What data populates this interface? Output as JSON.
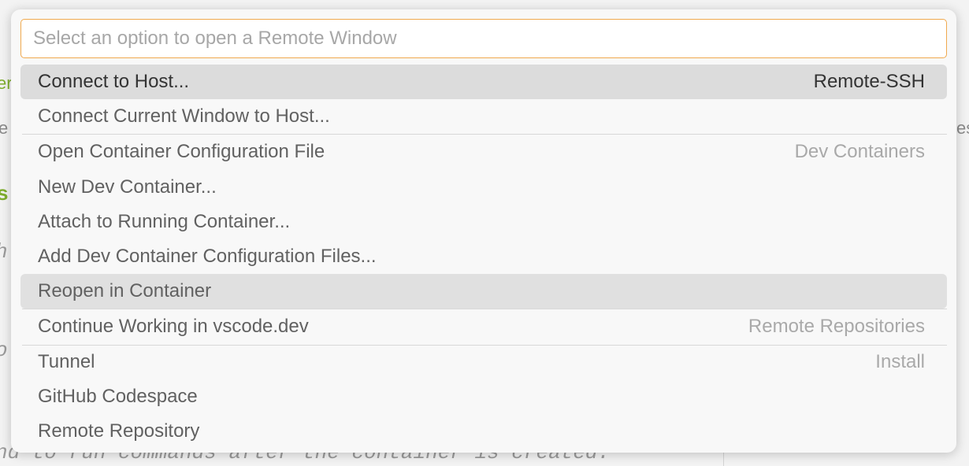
{
  "background_fragments": {
    "frag1": "er.",
    "frag2": "e",
    "frag3": "s",
    "frag4": "h",
    "frag5": "o",
    "frag6": "nd  to run commands after the container is created.",
    "frag7": "es"
  },
  "quick_pick": {
    "placeholder": "Select an option to open a Remote Window",
    "value": "",
    "items": [
      {
        "label": "Connect to Host...",
        "description": "Remote-SSH"
      },
      {
        "label": "Connect Current Window to Host...",
        "description": ""
      },
      {
        "label": "Open Container Configuration File",
        "description": "Dev Containers"
      },
      {
        "label": "New Dev Container...",
        "description": ""
      },
      {
        "label": "Attach to Running Container...",
        "description": ""
      },
      {
        "label": "Add Dev Container Configuration Files...",
        "description": ""
      },
      {
        "label": "Reopen in Container",
        "description": ""
      },
      {
        "label": "Continue Working in vscode.dev",
        "description": "Remote Repositories"
      },
      {
        "label": "Tunnel",
        "description": "Install"
      },
      {
        "label": "GitHub Codespace",
        "description": ""
      },
      {
        "label": "Remote Repository",
        "description": ""
      }
    ]
  },
  "colors": {
    "focus_border": "#f0a94e",
    "active_row": "#dcdcdc",
    "hover_row": "#e0e0e0"
  }
}
